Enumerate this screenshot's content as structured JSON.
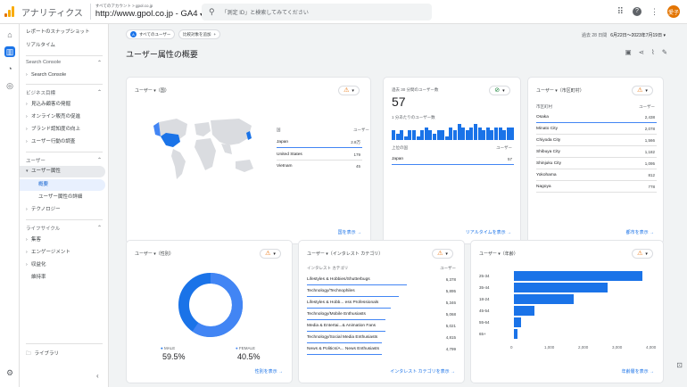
{
  "topbar": {
    "app_title": "アナリティクス",
    "account_small": "すべてのアカウント > gpol.co.jp",
    "property": "http://www.gpol.co.jp - GA4",
    "search_placeholder": "「測定 ID」と検索してみてください",
    "avatar_text": "愛子"
  },
  "sidenav": {
    "top_items": [
      "レポートのスナップショット",
      "リアルタイム"
    ],
    "sections": [
      {
        "title": "Search Console",
        "items": [
          "Search Console"
        ]
      },
      {
        "title": "ビジネス目標",
        "items": [
          "見込み顧客の発掘",
          "オンライン販売の促進",
          "ブランド認知度の向上",
          "ユーザー行動の調査"
        ]
      },
      {
        "title": "ユーザー",
        "items": [
          "ユーザー属性",
          "概要",
          "ユーザー属性の詳細",
          "テクノロジー"
        ]
      },
      {
        "title": "ライフサイクル",
        "items": [
          "集客",
          "エンゲージメント",
          "収益化",
          "維持率"
        ]
      }
    ],
    "library": "ライブラリ"
  },
  "main": {
    "chip_all_users": "すべてのユーザー",
    "chip_compare": "比較対象を追加",
    "date_label": "過去 28 日間",
    "date_range": "6月22日～2023年7月19日",
    "page_title": "ユーザー属性の概要"
  },
  "country_card": {
    "title": "ユーザー ▾（国）",
    "col_country": "国",
    "col_users": "ユーザー",
    "rows": [
      {
        "name": "Japan",
        "value": "2.8万"
      },
      {
        "name": "United States",
        "value": "179"
      },
      {
        "name": "Vietnam",
        "value": "45"
      }
    ],
    "link": "国を表示 →"
  },
  "realtime_card": {
    "title": "過去 30 分間のユーザー数",
    "big_value": "57",
    "per_minute": "1 分あたりのユーザー数",
    "bar_values": [
      3,
      2,
      3,
      1,
      3,
      3,
      1,
      3,
      4,
      3,
      2,
      3,
      3,
      1,
      4,
      3,
      5,
      4,
      3,
      4,
      5,
      4,
      3,
      4,
      3,
      4,
      4,
      3,
      4,
      4
    ],
    "col_country": "上位の国",
    "col_users": "ユーザー",
    "rows": [
      {
        "name": "Japan",
        "value": "57"
      }
    ],
    "link": "リアルタイムを表示 →"
  },
  "city_card": {
    "title": "ユーザー ▾（市区町村）",
    "col_city": "市区町村",
    "col_users": "ユーザー",
    "rows": [
      {
        "name": "Osaka",
        "value": "2,438"
      },
      {
        "name": "Minato City",
        "value": "2,078"
      },
      {
        "name": "Chiyoda City",
        "value": "1,566"
      },
      {
        "name": "Shibuya City",
        "value": "1,182"
      },
      {
        "name": "Shinjuku City",
        "value": "1,095"
      },
      {
        "name": "Yokohama",
        "value": "812"
      },
      {
        "name": "Nagoya",
        "value": "778"
      }
    ],
    "link": "都市を表示 →"
  },
  "gender_card": {
    "title": "ユーザー ▾（性別）",
    "male_label": "MALE",
    "male_value": "59.5%",
    "female_label": "FEMALE",
    "female_value": "40.5%",
    "male_fraction": 0.595,
    "link": "性別を表示 →"
  },
  "interest_card": {
    "title": "ユーザー ▾（インタレスト カテゴリ）",
    "col_cat": "インタレスト カテゴリ",
    "col_users": "ユーザー",
    "rows": [
      {
        "name": "Lifestyles & Hobbies/Shutterbugs",
        "value": "6,378",
        "frac": 1.0
      },
      {
        "name": "Technology/Technophiles",
        "value": "5,895",
        "frac": 0.92
      },
      {
        "name": "Lifestyles & Hobb... ess Professionals",
        "value": "5,346",
        "frac": 0.84
      },
      {
        "name": "Technology/Mobile Enthusiasts",
        "value": "5,068",
        "frac": 0.79
      },
      {
        "name": "Media & Entertai...& Animation Fans",
        "value": "5,021",
        "frac": 0.79
      },
      {
        "name": "Technology/Social Media Enthusiasts",
        "value": "4,815",
        "frac": 0.75
      },
      {
        "name": "News & Politics/A... News Enthusiasts",
        "value": "4,799",
        "frac": 0.75
      }
    ],
    "link": "インタレスト カテゴリを表示 →"
  },
  "age_card": {
    "title": "ユーザー ▾（年齢）",
    "link": "年齢層を表示 →"
  },
  "chart_data": {
    "type": "bar",
    "orientation": "horizontal",
    "categories": [
      "25-34",
      "35-44",
      "18-24",
      "45-54",
      "55-64",
      "65+"
    ],
    "values": [
      3800,
      2750,
      1750,
      600,
      200,
      100
    ],
    "xlim": [
      0,
      4000
    ],
    "xticks": [
      "0",
      "1,000",
      "2,000",
      "3,000",
      "4,000"
    ]
  }
}
